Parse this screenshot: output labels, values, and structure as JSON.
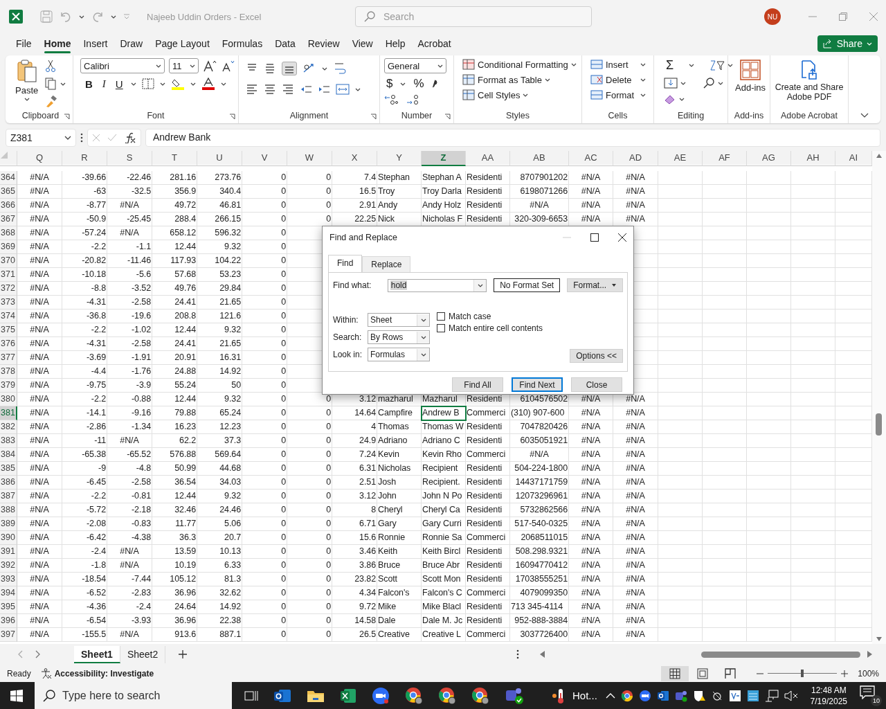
{
  "window": {
    "title": "Najeeb Uddin Orders  -  Excel",
    "search_placeholder": "Search",
    "avatar": "NU"
  },
  "menu": [
    {
      "label": "File",
      "selected": false
    },
    {
      "label": "Home",
      "selected": true
    },
    {
      "label": "Insert",
      "selected": false
    },
    {
      "label": "Draw",
      "selected": false
    },
    {
      "label": "Page Layout",
      "selected": false
    },
    {
      "label": "Formulas",
      "selected": false
    },
    {
      "label": "Data",
      "selected": false
    },
    {
      "label": "Review",
      "selected": false
    },
    {
      "label": "View",
      "selected": false
    },
    {
      "label": "Help",
      "selected": false
    },
    {
      "label": "Acrobat",
      "selected": false
    }
  ],
  "share": "Share",
  "ribbon": [
    {
      "kind": "clipboard",
      "label": "Clipboard",
      "paste": "Paste"
    },
    {
      "kind": "font",
      "label": "Font",
      "font": "Calibri",
      "size": "11",
      "styles": [
        "B",
        "I",
        "U"
      ]
    },
    {
      "kind": "alignment",
      "label": "Alignment"
    },
    {
      "kind": "number",
      "label": "Number",
      "format": "General",
      "symbols": [
        "$",
        "%"
      ]
    },
    {
      "kind": "styles",
      "label": "Styles",
      "items": [
        "Conditional Formatting",
        "Format as Table",
        "Cell Styles"
      ]
    },
    {
      "kind": "cells",
      "label": "Cells",
      "items": [
        "Insert",
        "Delete",
        "Format"
      ]
    },
    {
      "kind": "editing",
      "label": "Editing",
      "sigma": "Σ"
    },
    {
      "kind": "addins",
      "label": "Add-ins",
      "button": "Add-ins"
    },
    {
      "kind": "acrobat",
      "label": "Adobe Acrobat",
      "button": "Create and Share Adobe PDF"
    }
  ],
  "formula_bar": {
    "name_box": "Z381",
    "formula": "Andrew Bank"
  },
  "columns": [
    {
      "label": "Q",
      "selected": false
    },
    {
      "label": "R",
      "selected": false
    },
    {
      "label": "S",
      "selected": false
    },
    {
      "label": "T",
      "selected": false
    },
    {
      "label": "U",
      "selected": false
    },
    {
      "label": "V",
      "selected": false
    },
    {
      "label": "W",
      "selected": false
    },
    {
      "label": "X",
      "selected": false
    },
    {
      "label": "Y",
      "selected": false
    },
    {
      "label": "Z",
      "selected": true
    },
    {
      "label": "AA",
      "selected": false
    },
    {
      "label": "AB",
      "selected": false
    },
    {
      "label": "AC",
      "selected": false
    },
    {
      "label": "AD",
      "selected": false
    },
    {
      "label": "AE",
      "selected": false
    },
    {
      "label": "AF",
      "selected": false
    },
    {
      "label": "AG",
      "selected": false
    },
    {
      "label": "AH",
      "selected": false
    },
    {
      "label": "AI",
      "selected": false
    }
  ],
  "rows": [
    {
      "number": "364",
      "selected": false,
      "cells": [
        "#N/A",
        "-39.66",
        "-22.46",
        "281.16",
        "273.76",
        "0",
        "0",
        "7.4",
        "Stephan",
        "Stephan A",
        "Residenti",
        "8707901202",
        "#N/A",
        "#N/A"
      ]
    },
    {
      "number": "365",
      "selected": false,
      "cells": [
        "#N/A",
        "-63",
        "-32.5",
        "356.9",
        "340.4",
        "0",
        "0",
        "16.5",
        "Troy",
        "Troy Darla",
        "Residenti",
        "6198071266",
        "#N/A",
        "#N/A"
      ]
    },
    {
      "number": "366",
      "selected": false,
      "cells": [
        "#N/A",
        "-8.77",
        "#N/A",
        "49.72",
        "46.81",
        "0",
        "0",
        "2.91",
        "Andy",
        "Andy Holz",
        "Residenti",
        "#N/A",
        "#N/A",
        "#N/A"
      ]
    },
    {
      "number": "367",
      "selected": false,
      "cells": [
        "#N/A",
        "-50.9",
        "-25.45",
        "288.4",
        "266.15",
        "0",
        "0",
        "22.25",
        "Nick",
        "Nicholas F",
        "Residenti",
        "320-309-6653",
        "#N/A",
        "#N/A"
      ]
    },
    {
      "number": "368",
      "selected": false,
      "cells": [
        "#N/A",
        "-57.24",
        "#N/A",
        "658.12",
        "596.32",
        "0"
      ]
    },
    {
      "number": "369",
      "selected": false,
      "cells": [
        "#N/A",
        "-2.2",
        "-1.1",
        "12.44",
        "9.32",
        "0"
      ]
    },
    {
      "number": "370",
      "selected": false,
      "cells": [
        "#N/A",
        "-20.82",
        "-11.46",
        "117.93",
        "104.22",
        "0"
      ]
    },
    {
      "number": "371",
      "selected": false,
      "cells": [
        "#N/A",
        "-10.18",
        "-5.6",
        "57.68",
        "53.23",
        "0"
      ]
    },
    {
      "number": "372",
      "selected": false,
      "cells": [
        "#N/A",
        "-8.8",
        "-3.52",
        "49.76",
        "29.84",
        "0"
      ]
    },
    {
      "number": "373",
      "selected": false,
      "cells": [
        "#N/A",
        "-4.31",
        "-2.58",
        "24.41",
        "21.65",
        "0"
      ]
    },
    {
      "number": "374",
      "selected": false,
      "cells": [
        "#N/A",
        "-36.8",
        "-19.6",
        "208.8",
        "121.6",
        "0"
      ]
    },
    {
      "number": "375",
      "selected": false,
      "cells": [
        "#N/A",
        "-2.2",
        "-1.02",
        "12.44",
        "9.32",
        "0"
      ]
    },
    {
      "number": "376",
      "selected": false,
      "cells": [
        "#N/A",
        "-4.31",
        "-2.58",
        "24.41",
        "21.65",
        "0"
      ]
    },
    {
      "number": "377",
      "selected": false,
      "cells": [
        "#N/A",
        "-3.69",
        "-1.91",
        "20.91",
        "16.31",
        "0"
      ]
    },
    {
      "number": "378",
      "selected": false,
      "cells": [
        "#N/A",
        "-4.4",
        "-1.76",
        "24.88",
        "14.92",
        "0"
      ]
    },
    {
      "number": "379",
      "selected": false,
      "cells": [
        "#N/A",
        "-9.75",
        "-3.9",
        "55.24",
        "50",
        "0"
      ]
    },
    {
      "number": "380",
      "selected": false,
      "cells": [
        "#N/A",
        "-2.2",
        "-0.88",
        "12.44",
        "9.32",
        "0",
        "0",
        "3.12",
        "mazharul",
        "Mazharul",
        "Residenti",
        "6104576502",
        "#N/A",
        "#N/A"
      ]
    },
    {
      "number": "381",
      "selected": true,
      "cells": [
        "#N/A",
        "-14.1",
        "-9.16",
        "79.88",
        "65.24",
        "0",
        "0",
        "14.64",
        "Campfire",
        "Andrew B",
        "Commerci",
        "(310) 907-600",
        "#N/A",
        "#N/A"
      ]
    },
    {
      "number": "382",
      "selected": false,
      "cells": [
        "#N/A",
        "-2.86",
        "-1.34",
        "16.23",
        "12.23",
        "0",
        "0",
        "4",
        "Thomas",
        "Thomas W",
        "Residenti",
        "7047820426",
        "#N/A",
        "#N/A"
      ]
    },
    {
      "number": "383",
      "selected": false,
      "cells": [
        "#N/A",
        "-11",
        "#N/A",
        "62.2",
        "37.3",
        "0",
        "0",
        "24.9",
        "Adriano",
        "Adriano C",
        "Residenti",
        "6035051921",
        "#N/A",
        "#N/A"
      ]
    },
    {
      "number": "384",
      "selected": false,
      "cells": [
        "#N/A",
        "-65.38",
        "-65.52",
        "576.88",
        "569.64",
        "0",
        "0",
        "7.24",
        "Kevin",
        "Kevin Rho",
        "Commerci",
        "#N/A",
        "#N/A",
        "#N/A"
      ]
    },
    {
      "number": "385",
      "selected": false,
      "cells": [
        "#N/A",
        "-9",
        "-4.8",
        "50.99",
        "44.68",
        "0",
        "0",
        "6.31",
        "Nicholas",
        "Recipient",
        "Residenti",
        "504-224-1800",
        "#N/A",
        "#N/A"
      ]
    },
    {
      "number": "386",
      "selected": false,
      "cells": [
        "#N/A",
        "-6.45",
        "-2.58",
        "36.54",
        "34.03",
        "0",
        "0",
        "2.51",
        "Josh",
        "Recipient.",
        "Residenti",
        "14437171759",
        "#N/A",
        "#N/A"
      ]
    },
    {
      "number": "387",
      "selected": false,
      "cells": [
        "#N/A",
        "-2.2",
        "-0.81",
        "12.44",
        "9.32",
        "0",
        "0",
        "3.12",
        "John",
        "John N Po",
        "Residenti",
        "12073296961",
        "#N/A",
        "#N/A"
      ]
    },
    {
      "number": "388",
      "selected": false,
      "cells": [
        "#N/A",
        "-5.72",
        "-2.18",
        "32.46",
        "24.46",
        "0",
        "0",
        "8",
        "Cheryl",
        "Cheryl Ca",
        "Residenti",
        "5732862566",
        "#N/A",
        "#N/A"
      ]
    },
    {
      "number": "389",
      "selected": false,
      "cells": [
        "#N/A",
        "-2.08",
        "-0.83",
        "11.77",
        "5.06",
        "0",
        "0",
        "6.71",
        "Gary",
        "Gary Curri",
        "Residenti",
        "517-540-0325",
        "#N/A",
        "#N/A"
      ]
    },
    {
      "number": "390",
      "selected": false,
      "cells": [
        "#N/A",
        "-6.42",
        "-4.38",
        "36.3",
        "20.7",
        "0",
        "0",
        "15.6",
        "Ronnie",
        "Ronnie Sa",
        "Commerci",
        "2068511015",
        "#N/A",
        "#N/A"
      ]
    },
    {
      "number": "391",
      "selected": false,
      "cells": [
        "#N/A",
        "-2.4",
        "#N/A",
        "13.59",
        "10.13",
        "0",
        "0",
        "3.46",
        "Keith",
        "Keith Bircl",
        "Residenti",
        "508.298.9321",
        "#N/A",
        "#N/A"
      ]
    },
    {
      "number": "392",
      "selected": false,
      "cells": [
        "#N/A",
        "-1.8",
        "#N/A",
        "10.19",
        "6.33",
        "0",
        "0",
        "3.86",
        "Bruce",
        "Bruce Abr",
        "Residenti",
        "16094770412",
        "#N/A",
        "#N/A"
      ]
    },
    {
      "number": "393",
      "selected": false,
      "cells": [
        "#N/A",
        "-18.54",
        "-7.44",
        "105.12",
        "81.3",
        "0",
        "0",
        "23.82",
        "Scott",
        "Scott Mon",
        "Residenti",
        "17038555251",
        "#N/A",
        "#N/A"
      ]
    },
    {
      "number": "394",
      "selected": false,
      "cells": [
        "#N/A",
        "-6.52",
        "-2.83",
        "36.96",
        "32.62",
        "0",
        "0",
        "4.34",
        "Falcon's",
        "Falcon's C",
        "Commerci",
        "4079099350",
        "#N/A",
        "#N/A"
      ]
    },
    {
      "number": "395",
      "selected": false,
      "cells": [
        "#N/A",
        "-4.36",
        "-2.4",
        "24.64",
        "14.92",
        "0",
        "0",
        "9.72",
        "Mike",
        "Mike Blacl",
        "Residenti",
        "713 345-4114",
        "#N/A",
        "#N/A"
      ]
    },
    {
      "number": "396",
      "selected": false,
      "cells": [
        "#N/A",
        "-6.54",
        "-3.93",
        "36.96",
        "22.38",
        "0",
        "0",
        "14.58",
        "Dale",
        "Dale M. Jc",
        "Residenti",
        "952-888-3884",
        "#N/A",
        "#N/A"
      ]
    },
    {
      "number": "397",
      "selected": false,
      "cells": [
        "#N/A",
        "-155.5",
        "#N/A",
        "913.6",
        "887.1",
        "0",
        "0",
        "26.5",
        "Creative",
        "Creative L",
        "Commerci",
        "3037726400",
        "#N/A",
        "#N/A"
      ]
    }
  ],
  "dialog": {
    "title": "Find and Replace",
    "tabs": [
      {
        "label": "Find",
        "selected": true
      },
      {
        "label": "Replace",
        "selected": false
      }
    ],
    "find_label": "Find what:",
    "find_value": "hold",
    "format_status": "No Format Set",
    "format_button": "Format...",
    "options": [
      {
        "label": "Within:",
        "value": "Sheet"
      },
      {
        "label": "Search:",
        "value": "By Rows"
      },
      {
        "label": "Look in:",
        "value": "Formulas"
      }
    ],
    "checkboxes": [
      {
        "label": "Match case",
        "checked": false
      },
      {
        "label": "Match entire cell contents",
        "checked": false
      }
    ],
    "options_button": "Options <<",
    "buttons": [
      {
        "label": "Find All",
        "default": false
      },
      {
        "label": "Find Next",
        "default": true
      },
      {
        "label": "Close",
        "default": false
      }
    ]
  },
  "sheets": [
    {
      "label": "Sheet1",
      "selected": true
    },
    {
      "label": "Sheet2",
      "selected": false
    }
  ],
  "status": {
    "ready": "Ready",
    "accessibility": "Accessibility: Investigate",
    "zoom": "100%",
    "zoom_level": {
      "level": 0.5
    }
  },
  "taskbar": {
    "search_placeholder": "Type here to search",
    "weather": "Hot...",
    "time": "12:48 AM",
    "date": "7/19/2025",
    "notifications": "10"
  }
}
